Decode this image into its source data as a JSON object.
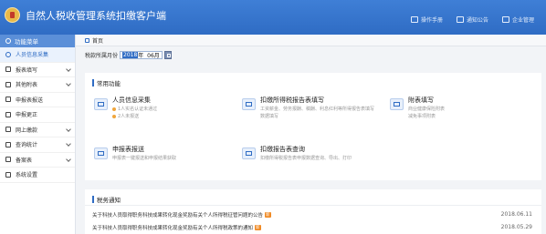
{
  "app": {
    "title": "自然人税收管理系统扣缴客户端"
  },
  "header": {
    "buttons": [
      {
        "label": "操作手册",
        "icon": "manual-icon"
      },
      {
        "label": "通知公告",
        "icon": "notice-icon"
      },
      {
        "label": "企业管理",
        "icon": "company-icon"
      }
    ]
  },
  "sidebar": {
    "heading": "功能菜单",
    "items": [
      {
        "label": "人员信息采集",
        "icon": "user-icon",
        "active": true,
        "chevron": false
      },
      {
        "label": "报表填写",
        "icon": "edit-icon",
        "active": false,
        "chevron": true
      },
      {
        "label": "其他附表",
        "icon": "table-icon",
        "active": false,
        "chevron": true
      },
      {
        "label": "申报表报送",
        "icon": "send-icon",
        "active": false,
        "chevron": false
      },
      {
        "label": "申报更正",
        "icon": "correct-icon",
        "active": false,
        "chevron": false
      },
      {
        "label": "网上缴款",
        "icon": "payment-icon",
        "active": false,
        "chevron": true
      },
      {
        "label": "查询统计",
        "icon": "search-icon",
        "active": false,
        "chevron": true
      },
      {
        "label": "备案表",
        "icon": "file-icon",
        "active": false,
        "chevron": true
      },
      {
        "label": "系统设置",
        "icon": "gear-icon",
        "active": false,
        "chevron": false
      }
    ]
  },
  "tab": {
    "label": "首页"
  },
  "period": {
    "label": "税款所属月份",
    "year": "2018",
    "year_suffix": "年",
    "month": "06月"
  },
  "common": {
    "title": "常用功能",
    "functions": [
      {
        "title": "人员信息采集",
        "lines": [
          "1人实名认证未通过",
          "2人未报送"
        ]
      },
      {
        "title": "扣缴所得税报告表填写",
        "lines": [
          "工资薪金、劳务报酬、稿酬、利息红利等所得报告表填写",
          "数据填写"
        ]
      },
      {
        "title": "附表填写",
        "lines": [
          "商业健康保险附表",
          "减免事项附表"
        ]
      },
      {
        "title": "申报表报送",
        "lines": [
          "申报表一键报送和申报结果获取"
        ]
      },
      {
        "title": "扣缴报告表查询",
        "lines": [
          "扣缴所得税报告表申报数据查询、导出、打印"
        ]
      }
    ]
  },
  "notices": {
    "title": "税务通知",
    "badge": "新",
    "items": [
      {
        "text": "关于科技人员取得职务科技成果转化现金奖励有关个人所得税征管问题的公告",
        "date": "2018.06.11"
      },
      {
        "text": "关于科技人员取得职务科技成果转化现金奖励有关个人所得税政策的通知",
        "date": "2018.05.29"
      }
    ]
  },
  "colors": {
    "header": "#2f6cc4",
    "accent": "#2f6cc4",
    "badge": "#f08a24"
  }
}
